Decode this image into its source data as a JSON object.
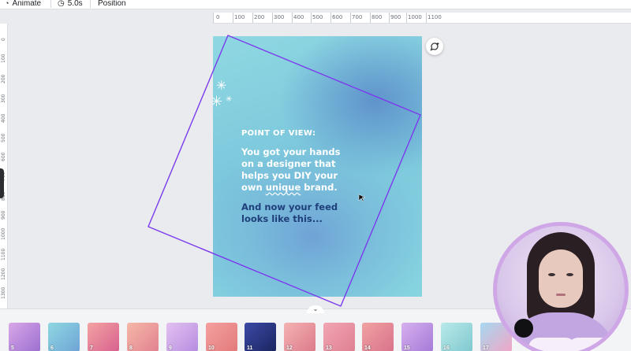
{
  "toolbar": {
    "animate_label": "Animate",
    "duration_label": "5.0s",
    "position_label": "Position"
  },
  "ruler_top": [
    "0",
    "100",
    "200",
    "300",
    "400",
    "500",
    "600",
    "700",
    "800",
    "900",
    "1000",
    "1100"
  ],
  "ruler_left": [
    "0",
    "100",
    "200",
    "300",
    "400",
    "500",
    "600",
    "700",
    "800",
    "900",
    "1000",
    "1100",
    "1200",
    "1300"
  ],
  "design": {
    "heading": "POINT OF VIEW:",
    "body_line1": "You got your hands",
    "body_line2": "on a designer that",
    "body_line3": "helps you DIY your",
    "body_line4_pre": "own ",
    "body_line4_underlined": "unique",
    "body_line4_post": " brand.",
    "body2_line1": "And now your feed",
    "body2_line2": "looks like this..."
  },
  "thumbnails": [
    "5",
    "6",
    "7",
    "8",
    "9",
    "10",
    "11",
    "12",
    "13",
    "14",
    "15",
    "16",
    "17"
  ],
  "colors": {
    "selection": "#7c3aed",
    "accent_text": "#1f3f7a"
  }
}
